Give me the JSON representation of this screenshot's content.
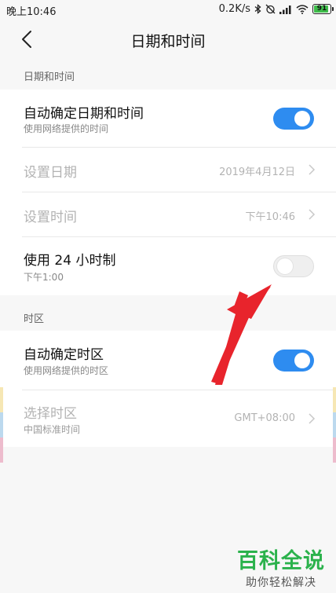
{
  "status_bar": {
    "time": "晚上10:46",
    "speed": "0.2K/s",
    "battery": "91"
  },
  "header": {
    "title": "日期和时间"
  },
  "section_datetime": {
    "label": "日期和时间",
    "rows": [
      {
        "title": "自动确定日期和时间",
        "subtitle": "使用网络提供的时间",
        "toggle": "on"
      },
      {
        "title": "设置日期",
        "value": "2019年4月12日"
      },
      {
        "title": "设置时间",
        "value": "下午10:46"
      },
      {
        "title": "使用 24 小时制",
        "subtitle": "下午1:00",
        "toggle": "off"
      }
    ]
  },
  "section_timezone": {
    "label": "时区",
    "rows": [
      {
        "title": "自动确定时区",
        "subtitle": "使用网络提供的时区",
        "toggle": "on"
      },
      {
        "title": "选择时区",
        "subtitle": "中国标准时间",
        "value": "GMT+08:00"
      }
    ]
  },
  "watermark": {
    "main": "百科全说",
    "sub": "助你轻松解决"
  },
  "colors": {
    "accent": "#2e8cf0",
    "arrow": "#e8242c",
    "watermark": "#2bb24c"
  }
}
